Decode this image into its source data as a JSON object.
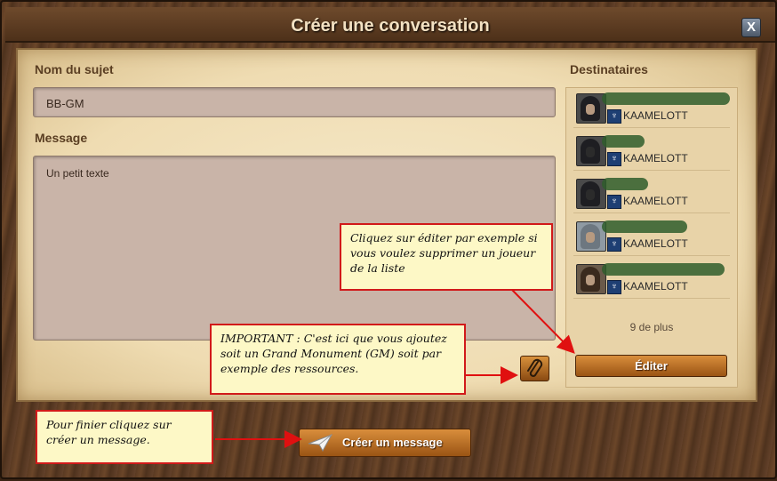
{
  "dialog": {
    "title": "Créer une conversation",
    "close_label": "X"
  },
  "form": {
    "subject_label": "Nom du sujet",
    "subject_value": "BB-GM",
    "message_label": "Message",
    "message_value": "Un petit texte"
  },
  "recipients": {
    "label": "Destinataires",
    "items": [
      {
        "guild": "KAAMELOTT"
      },
      {
        "guild": "KAAMELOTT"
      },
      {
        "guild": "KAAMELOTT"
      },
      {
        "guild": "KAAMELOTT"
      },
      {
        "guild": "KAAMELOTT"
      }
    ],
    "more_label": "9 de plus",
    "edit_label": "Éditer"
  },
  "footer": {
    "create_label": "Créer un message"
  },
  "annotations": {
    "edit_note": "Cliquez sur éditer par exemple si vous voulez supprimer un joueur de la liste",
    "important_note": "IMPORTANT : C'est ici que vous ajoutez soit un Grand Monument (GM) soit par exemple des ressources.",
    "finish_note": "Pour finier cliquez sur créer un message."
  },
  "colors": {
    "accent_button": "#c77a2a",
    "annotation_border": "#d11a1a",
    "annotation_bg": "#fdf8c6"
  }
}
